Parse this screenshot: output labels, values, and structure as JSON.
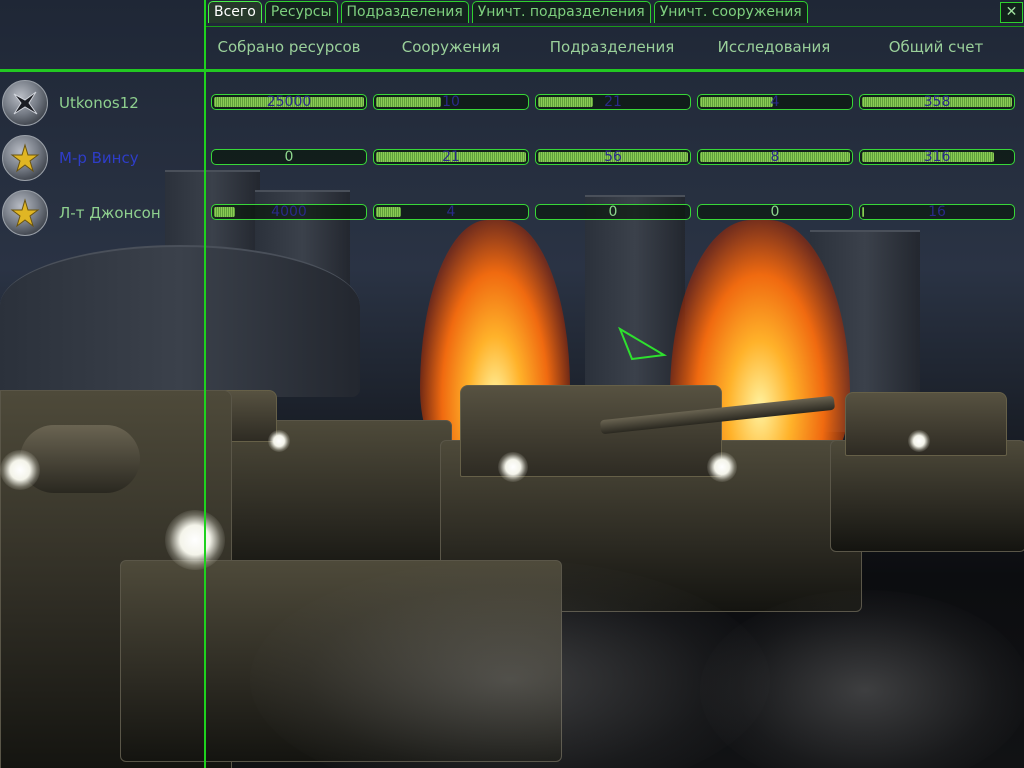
{
  "tabs": [
    {
      "label": "Всего",
      "active": true
    },
    {
      "label": "Ресурсы",
      "active": false
    },
    {
      "label": "Подразделения",
      "active": false
    },
    {
      "label": "Уничт. подразделения",
      "active": false
    },
    {
      "label": "Уничт. сооружения",
      "active": false
    }
  ],
  "close_label": "✕",
  "columns": [
    "Собрано ресурсов",
    "Сооружения",
    "Подразделения",
    "Исследования",
    "Общий счет"
  ],
  "players": [
    {
      "name": "Utkonos12",
      "name_color": "#8fd08f",
      "avatar_icon": "faction-emblem-icon",
      "stats": [
        {
          "value": "25000",
          "fill": 1.0
        },
        {
          "value": "10",
          "fill": 0.45
        },
        {
          "value": "21",
          "fill": 0.38
        },
        {
          "value": "4",
          "fill": 0.5
        },
        {
          "value": "358",
          "fill": 1.0
        }
      ]
    },
    {
      "name": "М-р Винсу",
      "name_color": "#2e3dc8",
      "avatar_icon": "star-emblem-icon",
      "stats": [
        {
          "value": "0",
          "fill": 0.0
        },
        {
          "value": "21",
          "fill": 1.0
        },
        {
          "value": "56",
          "fill": 1.0
        },
        {
          "value": "8",
          "fill": 1.0
        },
        {
          "value": "316",
          "fill": 0.88
        }
      ]
    },
    {
      "name": "Л-т Джонсон",
      "name_color": "#8fd08f",
      "avatar_icon": "star-emblem-icon",
      "stats": [
        {
          "value": "4000",
          "fill": 0.16
        },
        {
          "value": "4",
          "fill": 0.19
        },
        {
          "value": "0",
          "fill": 0.0
        },
        {
          "value": "0",
          "fill": 0.0
        },
        {
          "value": "16",
          "fill": 0.04
        }
      ]
    }
  ],
  "colors": {
    "hud_green": "#1ed21e",
    "value_text": "#2a2a88"
  }
}
